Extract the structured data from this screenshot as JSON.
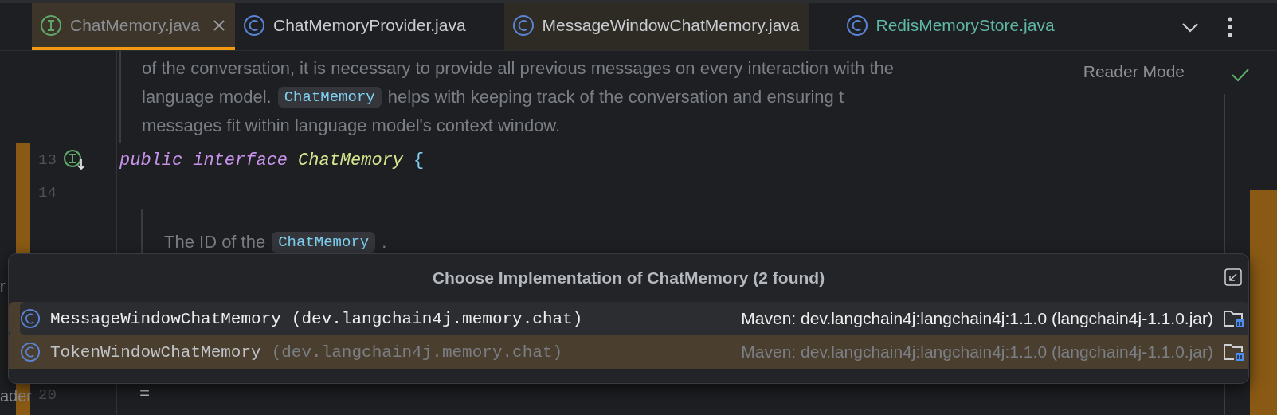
{
  "tabs": [
    {
      "label": "ChatMemory.java",
      "kind": "interface",
      "selected": true,
      "highlighted": true,
      "closable": true,
      "color": "#8c8f94"
    },
    {
      "label": "ChatMemoryProvider.java",
      "kind": "class",
      "selected": false,
      "highlighted": false,
      "closable": false,
      "color": "#c9ccd1"
    },
    {
      "label": "MessageWindowChatMemory.java",
      "kind": "class",
      "selected": false,
      "highlighted": true,
      "closable": false,
      "color": "#c9ccd1"
    },
    {
      "label": "RedisMemoryStore.java",
      "kind": "class",
      "selected": false,
      "highlighted": false,
      "closable": false,
      "color": "#5fb8a6"
    }
  ],
  "reader_mode": "Reader Mode",
  "doc_block": [
    [
      {
        "kind": "text",
        "text": "of the conversation, it is necessary to provide all previous messages on every interaction with the"
      }
    ],
    [
      {
        "kind": "text",
        "text": "language model."
      },
      {
        "kind": "code",
        "text": "ChatMemory"
      },
      {
        "kind": "text",
        "text": "helps with keeping track of the conversation and ensuring t"
      }
    ],
    [
      {
        "kind": "text",
        "text": "messages fit within language model's context window."
      }
    ]
  ],
  "code_lines": [
    {
      "number": "13",
      "implemented": true,
      "tokens": [
        {
          "kind": "keyword",
          "text": "public"
        },
        {
          "kind": "keyword",
          "text": "interface"
        },
        {
          "kind": "type",
          "text": "ChatMemory"
        },
        {
          "kind": "brace",
          "text": "{"
        }
      ]
    },
    {
      "number": "14",
      "implemented": false
    }
  ],
  "doc_block_2": [
    {
      "kind": "text",
      "text": "The ID of the"
    },
    {
      "kind": "code",
      "text": "ChatMemory"
    },
    {
      "kind": "text",
      "text": "."
    }
  ],
  "last_line": {
    "number": "20",
    "text": "="
  },
  "side_fragments": [
    "r",
    "ader"
  ],
  "popup": {
    "title": "Choose Implementation of ChatMemory (2 found)",
    "items": [
      {
        "name": "MessageWindowChatMemory",
        "package": "(dev.langchain4j.memory.chat)",
        "location": "Maven: dev.langchain4j:langchain4j:1.1.0 (langchain4j-1.1.0.jar)",
        "selected": true
      },
      {
        "name": "TokenWindowChatMemory",
        "package": "(dev.langchain4j.memory.chat)",
        "location": "Maven: dev.langchain4j:langchain4j:1.1.0 (langchain4j-1.1.0.jar)",
        "selected": false
      }
    ]
  }
}
